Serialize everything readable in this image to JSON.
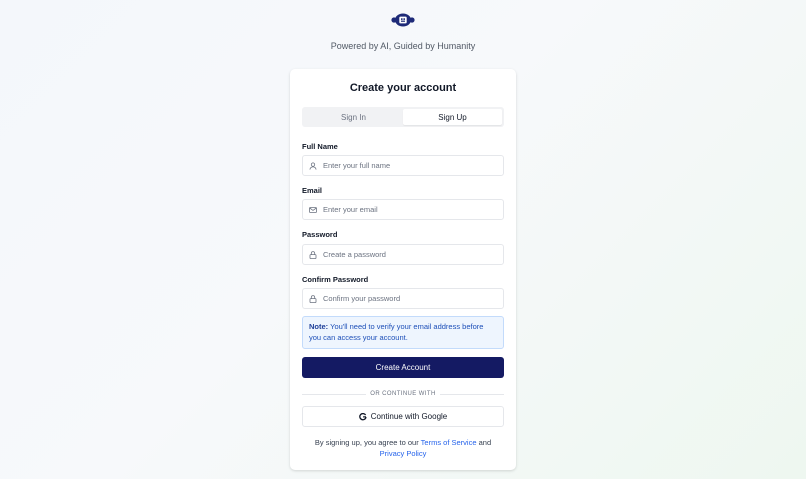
{
  "app": {
    "tagline": "Powered by AI, Guided by Humanity"
  },
  "card": {
    "title": "Create your account",
    "tabs": [
      {
        "label": "Sign In",
        "active": false
      },
      {
        "label": "Sign Up",
        "active": true
      }
    ],
    "fields": [
      {
        "label": "Full Name",
        "placeholder": "Enter your full name",
        "value": "",
        "icon": "user-icon"
      },
      {
        "label": "Email",
        "placeholder": "Enter your email",
        "value": "",
        "icon": "mail-icon"
      },
      {
        "label": "Password",
        "placeholder": "Create a password",
        "value": "",
        "icon": "lock-icon"
      },
      {
        "label": "Confirm Password",
        "placeholder": "Confirm your password",
        "value": "",
        "icon": "lock-icon"
      }
    ],
    "note": {
      "prefix": "Note:",
      "text": "You'll need to verify your email address before you can access your account."
    },
    "submit_label": "Create Account",
    "divider_text": "OR CONTINUE WITH",
    "google_label": "Continue with Google",
    "terms": {
      "prefix": "By signing up, you agree to our",
      "terms_link": "Terms of Service",
      "conjunction": "and",
      "privacy_link": "Privacy Policy"
    }
  },
  "colors": {
    "primary": "#141a63",
    "link": "#2563eb",
    "note_bg": "#eef5fe",
    "note_border": "#c3dbfb",
    "logo": "#1e2a78"
  }
}
